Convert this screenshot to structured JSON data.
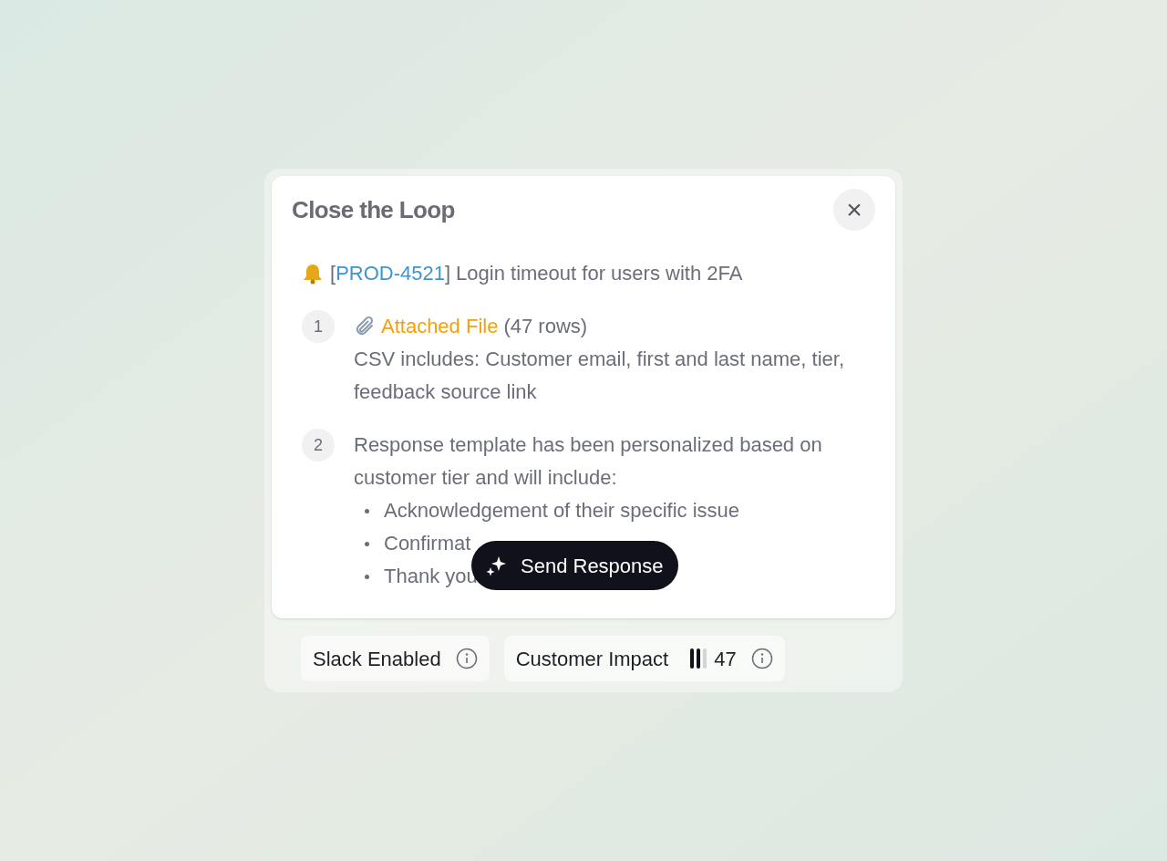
{
  "dialog": {
    "title": "Close the Loop",
    "close_label": "×"
  },
  "ticket": {
    "open": "[",
    "id": "PROD-4521",
    "close": "]",
    "title": "Login timeout for users with 2FA"
  },
  "steps": [
    {
      "number": "1",
      "kind": "file",
      "link": "Attached File",
      "link_note": "(47 rows)",
      "text": "CSV includes: Customer email, first and last name, tier, feedback source link"
    },
    {
      "number": "2",
      "kind": "list",
      "text": "Response template has been personalized based on customer tier and will include:",
      "bullets": [
        "Acknowledgement of their specific issue",
        "Confirmat",
        "Thank you"
      ]
    }
  ],
  "send_button": {
    "label": "Send Response"
  },
  "footer": [
    {
      "kind": "label",
      "label": "Slack Enabled"
    },
    {
      "kind": "meter",
      "label": "Customer Impact",
      "level": 0.67,
      "value": "47"
    }
  ]
}
